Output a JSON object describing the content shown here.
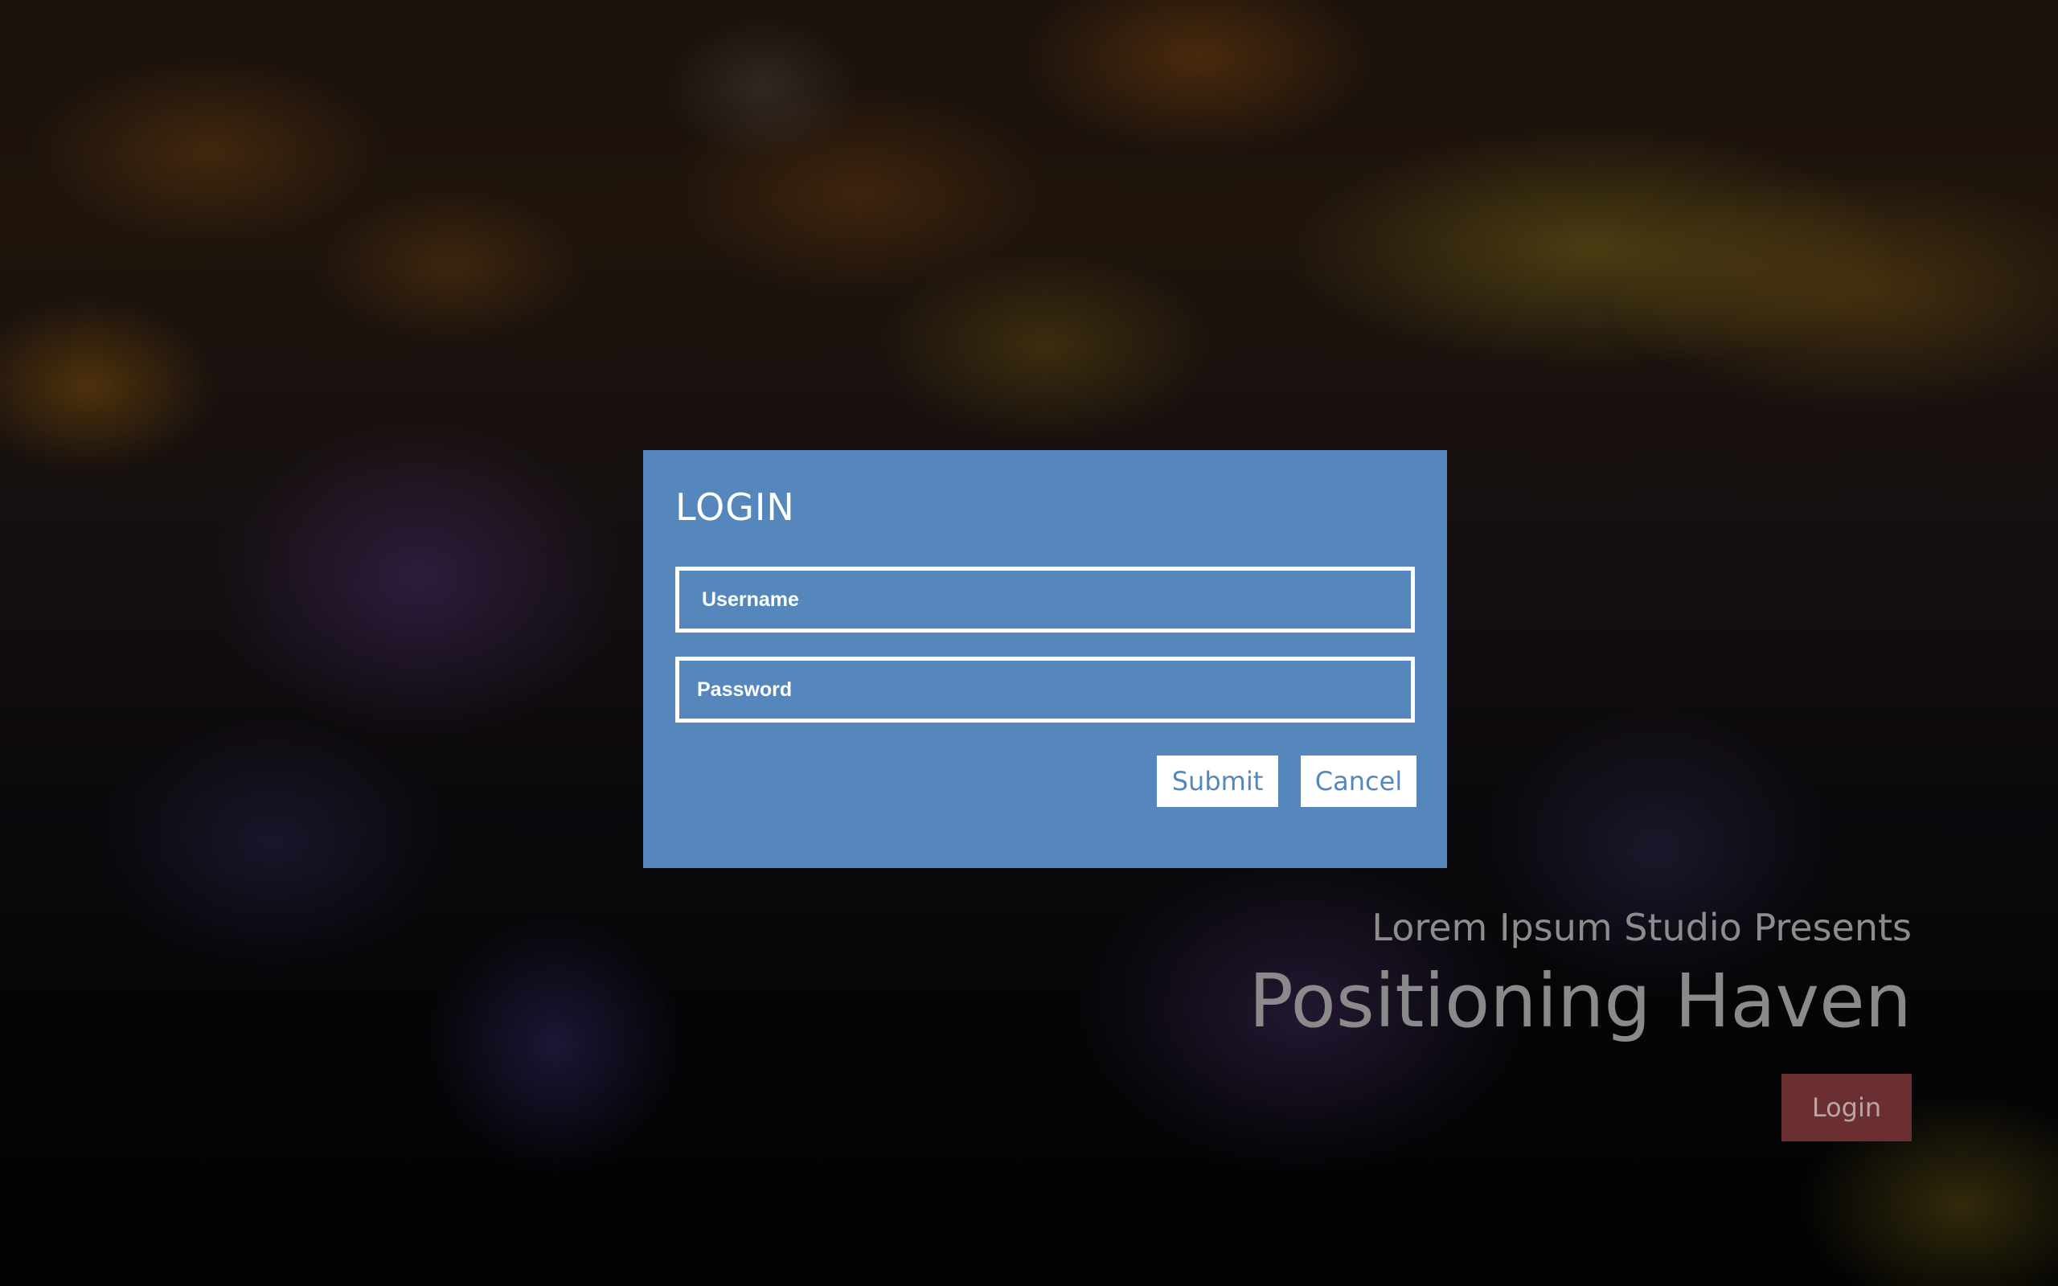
{
  "modal": {
    "title": "LOGIN",
    "username_placeholder": "Username",
    "password_placeholder": "Password",
    "submit_label": "Submit",
    "cancel_label": "Cancel",
    "background_color": "#5587bd"
  },
  "hero": {
    "subtitle": "Lorem Ipsum Studio Presents",
    "title": "Positioning Haven",
    "login_label": "Login",
    "login_button_color": "#6b2e31"
  }
}
